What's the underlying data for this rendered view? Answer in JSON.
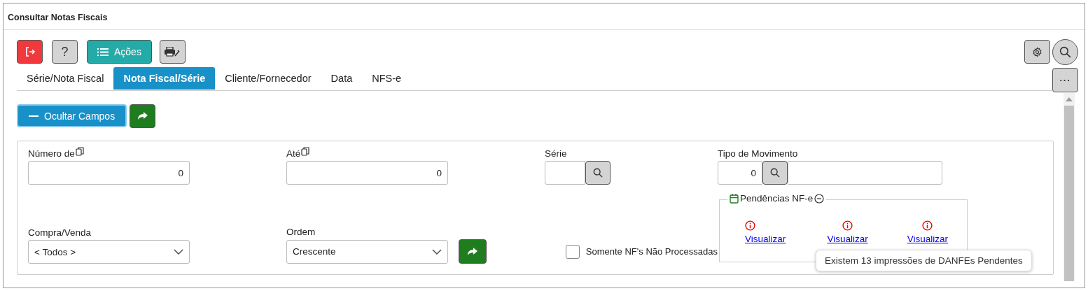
{
  "window": {
    "title": "Consultar Notas Fiscais"
  },
  "toolbar": [
    {
      "kind": "exit"
    },
    {
      "kind": "help",
      "label": "?"
    },
    {
      "kind": "actions",
      "label": "Ações"
    },
    {
      "kind": "print"
    }
  ],
  "toolbar_right": [
    {
      "kind": "settings"
    },
    {
      "kind": "search"
    }
  ],
  "tabs": [
    {
      "label": "Série/Nota Fiscal",
      "selected": false
    },
    {
      "label": "Nota Fiscal/Série",
      "selected": true
    },
    {
      "label": "Cliente/Fornecedor",
      "selected": false
    },
    {
      "label": "Data",
      "selected": false
    },
    {
      "label": "NFS-e",
      "selected": false
    }
  ],
  "more_button": {
    "label": "···"
  },
  "toggle_button": {
    "label": "Ocultar Campos",
    "expanded": true
  },
  "fields": {
    "numero_de": {
      "label": "Número de",
      "value": "0"
    },
    "ate": {
      "label": "Até",
      "value": "0"
    },
    "serie": {
      "label": "Série"
    },
    "tipo_movimento": {
      "label": "Tipo de Movimento",
      "value": "0"
    },
    "compra_venda": {
      "label": "Compra/Venda",
      "value": "< Todos >"
    },
    "ordem": {
      "label": "Ordem",
      "value": "Crescente"
    }
  },
  "checkbox": {
    "label": "Somente NF's Não Processadas",
    "checked": false
  },
  "pendencias": {
    "title": "Pendências NF-e",
    "items": [
      {
        "label": "Visualizar"
      },
      {
        "label": "Visualizar"
      },
      {
        "label": "Visualizar"
      }
    ]
  },
  "tooltip": "Existem 13 impressões de DANFEs Pendentes"
}
